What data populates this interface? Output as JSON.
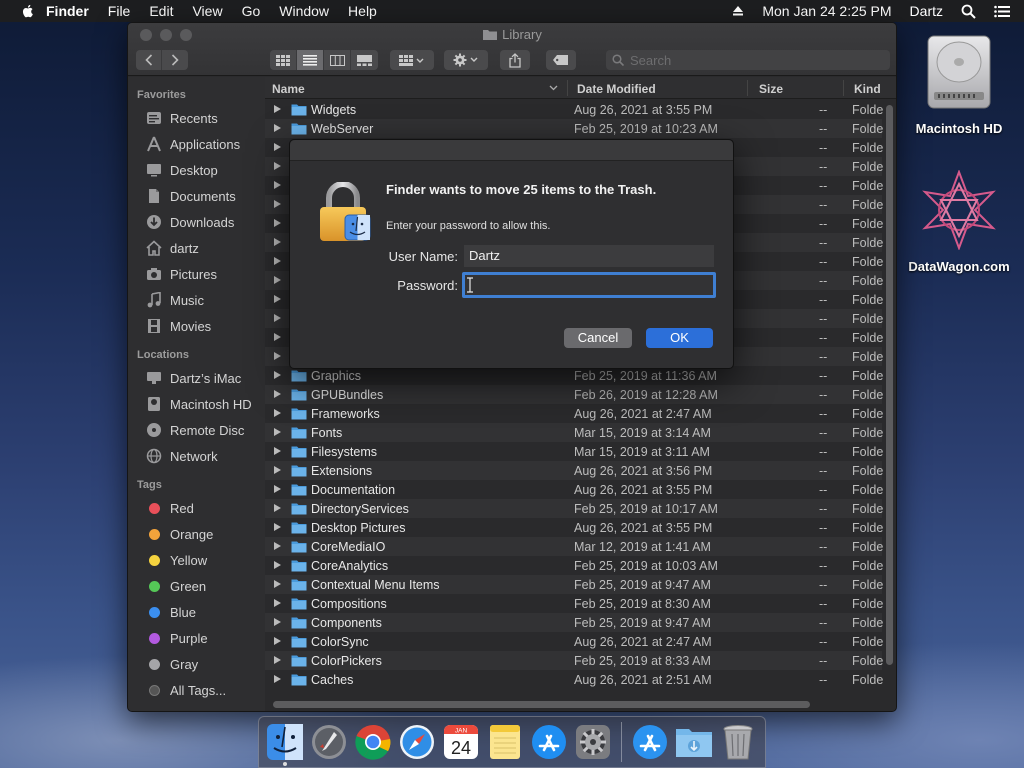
{
  "menubar": {
    "app_name": "Finder",
    "menus": [
      "File",
      "Edit",
      "View",
      "Go",
      "Window",
      "Help"
    ],
    "clock": "Mon Jan 24  2:25 PM",
    "user": "Dartz"
  },
  "desktop": {
    "icons": [
      {
        "label": "Macintosh HD"
      },
      {
        "label": "DataWagon.com"
      }
    ]
  },
  "window": {
    "title": "Library",
    "search_placeholder": "Search",
    "columns": {
      "name": "Name",
      "date": "Date Modified",
      "size": "Size",
      "kind": "Kind"
    }
  },
  "sidebar": {
    "favorites_header": "Favorites",
    "favorites": [
      "Recents",
      "Applications",
      "Desktop",
      "Documents",
      "Downloads",
      "dartz",
      "Pictures",
      "Music",
      "Movies"
    ],
    "locations_header": "Locations",
    "locations": [
      "Dartz’s iMac",
      "Macintosh HD",
      "Remote Disc",
      "Network"
    ],
    "tags_header": "Tags",
    "tags": [
      {
        "label": "Red",
        "color": "#e9505a"
      },
      {
        "label": "Orange",
        "color": "#f3a33b"
      },
      {
        "label": "Yellow",
        "color": "#f5d33f"
      },
      {
        "label": "Green",
        "color": "#55c757"
      },
      {
        "label": "Blue",
        "color": "#3b8ff0"
      },
      {
        "label": "Purple",
        "color": "#b35ae0"
      },
      {
        "label": "Gray",
        "color": "#a5a5a8"
      },
      {
        "label": "All Tags..."
      }
    ]
  },
  "files": [
    {
      "name": "Widgets",
      "date": "Aug 26, 2021 at 3:55 PM",
      "size": "--",
      "kind": "Folde"
    },
    {
      "name": "WebServer",
      "date": "Feb 25, 2019 at 10:23 AM",
      "size": "--",
      "kind": "Folde"
    },
    {
      "name": "",
      "date": "",
      "size": "--",
      "kind": "Folde"
    },
    {
      "name": "",
      "date": "",
      "size": "--",
      "kind": "Folde"
    },
    {
      "name": "",
      "date": "",
      "size": "--",
      "kind": "Folde"
    },
    {
      "name": "",
      "date": "",
      "size": "--",
      "kind": "Folde"
    },
    {
      "name": "",
      "date": "",
      "size": "--",
      "kind": "Folde"
    },
    {
      "name": "",
      "date": "",
      "size": "--",
      "kind": "Folde"
    },
    {
      "name": "",
      "date": "",
      "size": "--",
      "kind": "Folde"
    },
    {
      "name": "",
      "date": "",
      "size": "--",
      "kind": "Folde"
    },
    {
      "name": "",
      "date": "",
      "size": "--",
      "kind": "Folde"
    },
    {
      "name": "",
      "date": "",
      "size": "--",
      "kind": "Folde"
    },
    {
      "name": "",
      "date": "",
      "size": "--",
      "kind": "Folde"
    },
    {
      "name": "",
      "date": "",
      "size": "--",
      "kind": "Folde"
    },
    {
      "name": "Graphics",
      "date": "Feb 25, 2019 at 11:36 AM",
      "size": "--",
      "kind": "Folde"
    },
    {
      "name": "GPUBundles",
      "date": "Feb 26, 2019 at 12:28 AM",
      "size": "--",
      "kind": "Folde"
    },
    {
      "name": "Frameworks",
      "date": "Aug 26, 2021 at 2:47 AM",
      "size": "--",
      "kind": "Folde"
    },
    {
      "name": "Fonts",
      "date": "Mar 15, 2019 at 3:14 AM",
      "size": "--",
      "kind": "Folde"
    },
    {
      "name": "Filesystems",
      "date": "Mar 15, 2019 at 3:11 AM",
      "size": "--",
      "kind": "Folde"
    },
    {
      "name": "Extensions",
      "date": "Aug 26, 2021 at 3:56 PM",
      "size": "--",
      "kind": "Folde"
    },
    {
      "name": "Documentation",
      "date": "Aug 26, 2021 at 3:55 PM",
      "size": "--",
      "kind": "Folde"
    },
    {
      "name": "DirectoryServices",
      "date": "Feb 25, 2019 at 10:17 AM",
      "size": "--",
      "kind": "Folde"
    },
    {
      "name": "Desktop Pictures",
      "date": "Aug 26, 2021 at 3:55 PM",
      "size": "--",
      "kind": "Folde"
    },
    {
      "name": "CoreMediaIO",
      "date": "Mar 12, 2019 at 1:41 AM",
      "size": "--",
      "kind": "Folde"
    },
    {
      "name": "CoreAnalytics",
      "date": "Feb 25, 2019 at 10:03 AM",
      "size": "--",
      "kind": "Folde"
    },
    {
      "name": "Contextual Menu Items",
      "date": "Feb 25, 2019 at 9:47 AM",
      "size": "--",
      "kind": "Folde"
    },
    {
      "name": "Compositions",
      "date": "Feb 25, 2019 at 8:30 AM",
      "size": "--",
      "kind": "Folde"
    },
    {
      "name": "Components",
      "date": "Feb 25, 2019 at 9:47 AM",
      "size": "--",
      "kind": "Folde"
    },
    {
      "name": "ColorSync",
      "date": "Aug 26, 2021 at 2:47 AM",
      "size": "--",
      "kind": "Folde"
    },
    {
      "name": "ColorPickers",
      "date": "Feb 25, 2019 at 8:33 AM",
      "size": "--",
      "kind": "Folde"
    },
    {
      "name": "Caches",
      "date": "Aug 26, 2021 at 2:51 AM",
      "size": "--",
      "kind": "Folde"
    }
  ],
  "dialog": {
    "title": "Finder wants to move 25 items to the Trash.",
    "subtitle": "Enter your password to allow this.",
    "username_label": "User Name:",
    "username_value": "Dartz",
    "password_label": "Password:",
    "password_value": "",
    "cancel_label": "Cancel",
    "ok_label": "OK"
  },
  "dock": {
    "apps": [
      "finder-icon",
      "launchpad-icon",
      "chrome-icon",
      "safari-icon",
      "calendar-icon",
      "notes-icon",
      "app-store-icon",
      "system-preferences-icon",
      "app-store-folder-icon",
      "downloads-folder-icon",
      "trash-icon"
    ],
    "calendar_day": "24",
    "calendar_month": "JAN"
  }
}
